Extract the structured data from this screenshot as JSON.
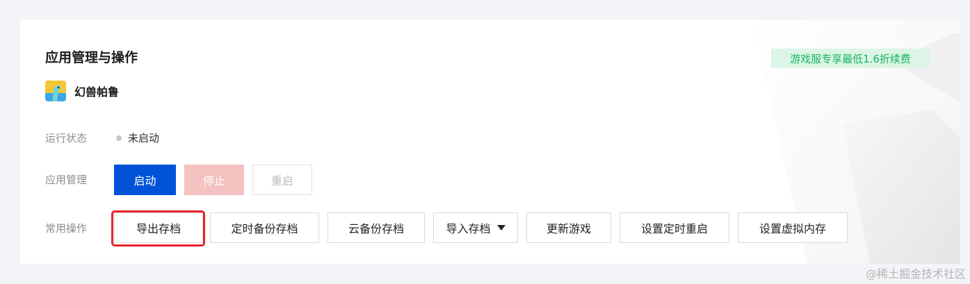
{
  "section": {
    "title": "应用管理与操作",
    "promo": "游戏服专享最低1.6折续费"
  },
  "app": {
    "name": "幻兽帕鲁",
    "icon": "palworld-app-icon"
  },
  "status": {
    "label": "运行状态",
    "value": "未启动",
    "dot_color": "#c6c6c6"
  },
  "management": {
    "label": "应用管理",
    "start": "启动",
    "stop": "停止",
    "restart": "重启"
  },
  "operations": {
    "label": "常用操作",
    "export_save": "导出存档",
    "scheduled_backup": "定时备份存档",
    "cloud_backup": "云备份存档",
    "import_save": "导入存档",
    "update_game": "更新游戏",
    "scheduled_restart": "设置定时重启",
    "virtual_memory": "设置虚拟内存"
  },
  "watermark": "@稀土掘金技术社区",
  "colors": {
    "primary": "#0052d9",
    "promo_text": "#16b461",
    "promo_bg": "#dcf5e6",
    "highlight": "#e8242a"
  }
}
